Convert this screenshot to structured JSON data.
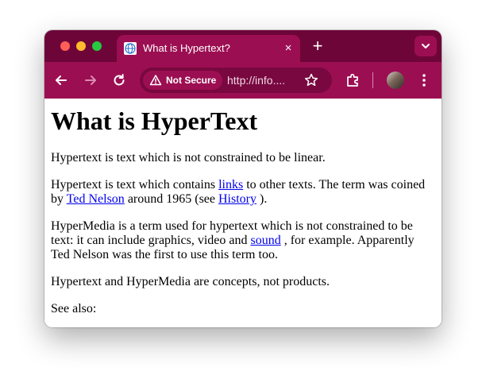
{
  "browser": {
    "tab_title": "What is Hypertext?",
    "tab_close_glyph": "×",
    "new_tab_glyph": "+",
    "security_label": "Not Secure",
    "url": "http://info....",
    "colors": {
      "titlebar": "#6e0538",
      "toolbar": "#9c0e52",
      "omnibox": "#78083f"
    }
  },
  "page": {
    "title": "What is HyperText",
    "p1": "Hypertext is text which is not constrained to be linear.",
    "p2": {
      "t1": "Hypertext is text which contains ",
      "link1": "links",
      "t2": " to other texts. The term was coined by ",
      "link2": "Ted Nelson",
      "t3": " around 1965 (see ",
      "link3": "History",
      "t4": " )."
    },
    "p3": {
      "t1": "HyperMedia is a term used for hypertext which is not constrained to be text: it can include graphics, video and ",
      "link1": "sound",
      "t2": " , for example. Apparently Ted Nelson was the first to use this term too."
    },
    "p4": "Hypertext and HyperMedia are concepts, not products.",
    "p5": "See also:"
  }
}
